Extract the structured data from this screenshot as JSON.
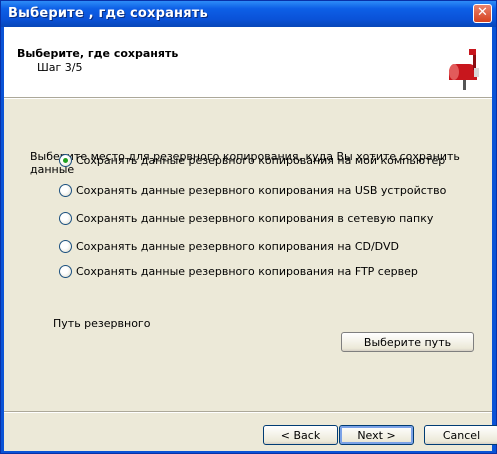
{
  "window": {
    "title": "Выберите , где сохранять",
    "close_label": "✕"
  },
  "header": {
    "title": "Выберите, где сохранять",
    "step": "Шаг 3/5",
    "icon": "mailbox-icon"
  },
  "main": {
    "instruction": "Выберите место для резервного копирования, куда Вы хотите сохранить данные",
    "options": [
      {
        "label": "Сохранять данные резервного копирования на мой компьютер",
        "selected": true
      },
      {
        "label": "Сохранять данные резервного копирования на USB устройство",
        "selected": false
      },
      {
        "label": "Сохранять данные резервного копирования в сетевую папку",
        "selected": false
      },
      {
        "label": "Сохранять данные резервного копирования на CD/DVD",
        "selected": false
      },
      {
        "label": "Сохранять данные резервного копирования на FTP сервер",
        "selected": false
      }
    ],
    "path_label": "Путь резервного",
    "choose_path_label": "Выберите путь"
  },
  "footer": {
    "back_label": "< Back",
    "next_label": "Next >",
    "cancel_label": "Cancel"
  },
  "colors": {
    "titlebar": "#0a52d8",
    "client_bg": "#ece9d8",
    "radio_dot": "#21a121",
    "close_button": "#d6421f",
    "mailbox": "#c8161d"
  }
}
